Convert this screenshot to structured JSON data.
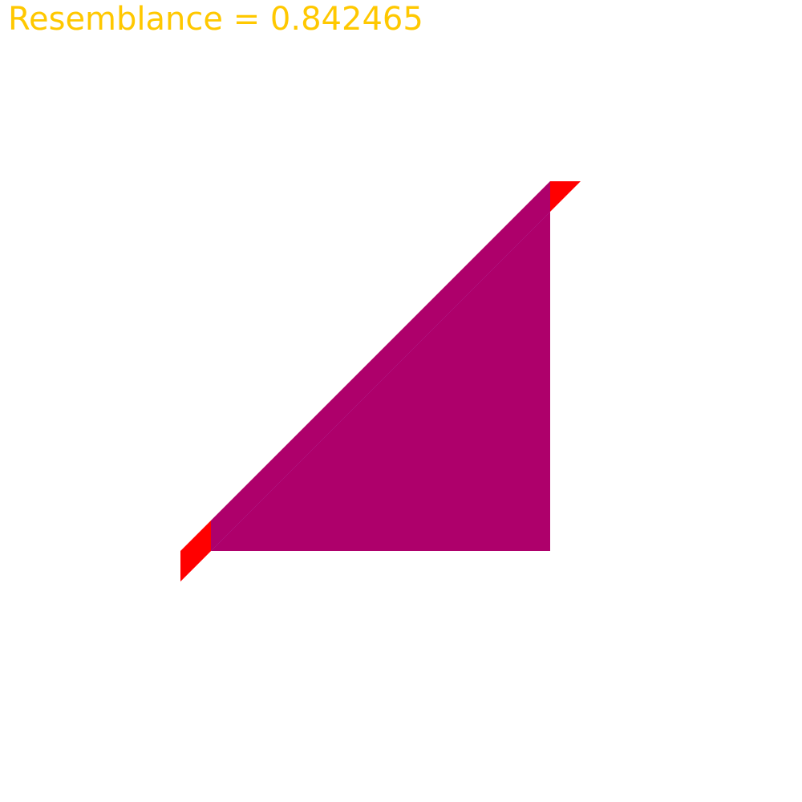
{
  "header": {
    "resemblance_text": "Resemblance = 0.842465"
  },
  "colors": {
    "text": "#ffc800",
    "background": "#ffffff",
    "red_shape": "#ff0000",
    "blue_shape": "#3f00ff"
  }
}
